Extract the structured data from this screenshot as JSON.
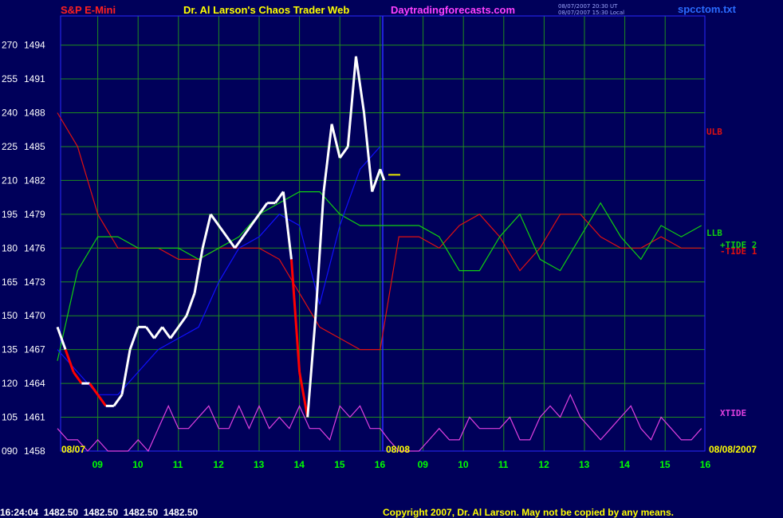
{
  "header": {
    "instrument": "S&P E-Mini",
    "brand": "Dr. Al Larson's Chaos Trader Web",
    "site": "Daytradingforecasts.com",
    "ts_line1": "08/07/2007 20:30 UT",
    "ts_line2": "08/07/2007 15:30 Local",
    "file": "spcctom.txt"
  },
  "footer": {
    "quote": "16:24:04  1482.50  1482.50  1482.50  1482.50",
    "copyright": "Copyright 2007, Dr. Al Larson. May not be copied by any means."
  },
  "colors": {
    "background": "#00005a",
    "grid": "#1e8c1e",
    "frame": "#2a2aff",
    "price": "#ffffff",
    "price_down": "#ff0000",
    "ulb": "#e01010",
    "llb": "#10d010",
    "xtide": "#e040e0",
    "tide1": "#e01010",
    "tide2": "#10d010",
    "ma": "#1010ff",
    "avg": "#e8e800"
  },
  "chart_data": {
    "type": "line",
    "title": "",
    "y_left_labels": [
      "270",
      "255",
      "240",
      "225",
      "210",
      "195",
      "180",
      "165",
      "150",
      "135",
      "120",
      "105",
      "090"
    ],
    "y_right_labels": [
      "1494",
      "1491",
      "1488",
      "1485",
      "1482",
      "1479",
      "1476",
      "1473",
      "1470",
      "1467",
      "1464",
      "1461",
      "1458"
    ],
    "ylim": [
      1458,
      1495.5
    ],
    "x_ticks_day1": [
      "09",
      "10",
      "11",
      "12",
      "13",
      "14",
      "15",
      "16"
    ],
    "x_ticks_day2": [
      "09",
      "10",
      "11",
      "12",
      "13",
      "14",
      "15",
      "16"
    ],
    "date_labels": [
      "08/07",
      "08/08",
      "08/08/2007"
    ],
    "series_labels": {
      "ulb": "ULB",
      "llb": "LLB",
      "tide2": "+TIDE 2",
      "tide1": "-TIDE 1",
      "xtide": "XTIDE"
    },
    "grid": true,
    "price_close": {
      "x": [
        8.0,
        8.2,
        8.4,
        8.6,
        8.8,
        9.0,
        9.2,
        9.4,
        9.6,
        9.8,
        10.0,
        10.2,
        10.4,
        10.6,
        10.8,
        11.0,
        11.2,
        11.4,
        11.6,
        11.8,
        12.0,
        12.2,
        12.4,
        12.6,
        12.8,
        13.0,
        13.2,
        13.4,
        13.6,
        13.8,
        14.0,
        14.2,
        14.4,
        14.6,
        14.8,
        15.0,
        15.2,
        15.4,
        15.6,
        15.8,
        16.0,
        16.1
      ],
      "y": [
        1469,
        1467,
        1465,
        1464,
        1464,
        1463,
        1462,
        1462,
        1463,
        1467,
        1469,
        1469,
        1468,
        1469,
        1468,
        1469,
        1470,
        1472,
        1476,
        1479,
        1478,
        1477,
        1476,
        1477,
        1478,
        1479,
        1480,
        1480,
        1481,
        1475,
        1465,
        1461,
        1470,
        1481,
        1487,
        1484,
        1485,
        1493,
        1488,
        1481,
        1483,
        1482
      ]
    },
    "series": [
      {
        "name": "ULB",
        "x": [
          8.0,
          8.5,
          9.0,
          9.5,
          10.0,
          10.5,
          11.0,
          11.5,
          12.0,
          12.5,
          13.0,
          13.5,
          14.0,
          14.5,
          15.0,
          15.5,
          16.0,
          16.5,
          17.0,
          17.5,
          18.0,
          18.5,
          19.0,
          19.5,
          20.0,
          20.5,
          21.0,
          21.5,
          22.0,
          22.5,
          23.0,
          23.5,
          24.0
        ],
        "y": [
          1488,
          1485,
          1479,
          1476,
          1476,
          1476,
          1475,
          1475,
          1476,
          1476,
          1476,
          1475,
          1472,
          1469,
          1468,
          1467,
          1467,
          1477,
          1477,
          1476,
          1478,
          1479,
          1477,
          1474,
          1476,
          1479,
          1479,
          1477,
          1476,
          1476,
          1477,
          1476,
          1476
        ]
      },
      {
        "name": "LLB",
        "x": [
          8.0,
          8.5,
          9.0,
          9.5,
          10.0,
          10.5,
          11.0,
          11.5,
          12.0,
          12.5,
          13.0,
          13.5,
          14.0,
          14.5,
          15.0,
          15.5,
          16.0,
          16.5,
          17.0,
          17.5,
          18.0,
          18.5,
          19.0,
          19.5,
          20.0,
          20.5,
          21.0,
          21.5,
          22.0,
          22.5,
          23.0,
          23.5,
          24.0
        ],
        "y": [
          1466,
          1474,
          1477,
          1477,
          1476,
          1476,
          1476,
          1475,
          1476,
          1477,
          1479,
          1480,
          1481,
          1481,
          1479,
          1478,
          1478,
          1478,
          1478,
          1477,
          1474,
          1474,
          1477,
          1479,
          1475,
          1474,
          1477,
          1480,
          1477,
          1475,
          1478,
          1477,
          1478
        ]
      },
      {
        "name": "XTIDE",
        "x": [
          8.0,
          8.25,
          8.5,
          8.75,
          9.0,
          9.25,
          9.5,
          9.75,
          10.0,
          10.25,
          10.5,
          10.75,
          11.0,
          11.25,
          11.5,
          11.75,
          12.0,
          12.25,
          12.5,
          12.75,
          13.0,
          13.25,
          13.5,
          13.75,
          14.0,
          14.25,
          14.5,
          14.75,
          15.0,
          15.25,
          15.5,
          15.75,
          16.0,
          16.25,
          16.5,
          16.75,
          17.0,
          17.25,
          17.5,
          17.75,
          18.0,
          18.25,
          18.5,
          18.75,
          19.0,
          19.25,
          19.5,
          19.75,
          20.0,
          20.25,
          20.5,
          20.75,
          21.0,
          21.25,
          21.5,
          21.75,
          22.0,
          22.25,
          22.5,
          22.75,
          23.0,
          23.25,
          23.5,
          23.75,
          24.0
        ],
        "y": [
          1460,
          1459,
          1459,
          1458,
          1459,
          1458,
          1458,
          1458,
          1459,
          1458,
          1460,
          1462,
          1460,
          1460,
          1461,
          1462,
          1460,
          1460,
          1462,
          1460,
          1462,
          1460,
          1461,
          1460,
          1462,
          1460,
          1460,
          1459,
          1462,
          1461,
          1462,
          1460,
          1460,
          1459,
          1458,
          1458,
          1458,
          1459,
          1460,
          1459,
          1459,
          1461,
          1460,
          1460,
          1460,
          1461,
          1459,
          1459,
          1461,
          1462,
          1461,
          1463,
          1461,
          1460,
          1459,
          1460,
          1461,
          1462,
          1460,
          1459,
          1461,
          1460,
          1459,
          1459,
          1460
        ]
      },
      {
        "name": "MA",
        "x": [
          8.0,
          8.5,
          9.0,
          9.5,
          10.0,
          10.5,
          11.0,
          11.5,
          12.0,
          12.5,
          13.0,
          13.5,
          14.0,
          14.5,
          15.0,
          15.5,
          16.0
        ],
        "y": [
          1467,
          1465,
          1463,
          1463,
          1465,
          1467,
          1468,
          1469,
          1473,
          1476,
          1477,
          1479,
          1478,
          1471,
          1478,
          1483,
          1485
        ]
      }
    ]
  }
}
